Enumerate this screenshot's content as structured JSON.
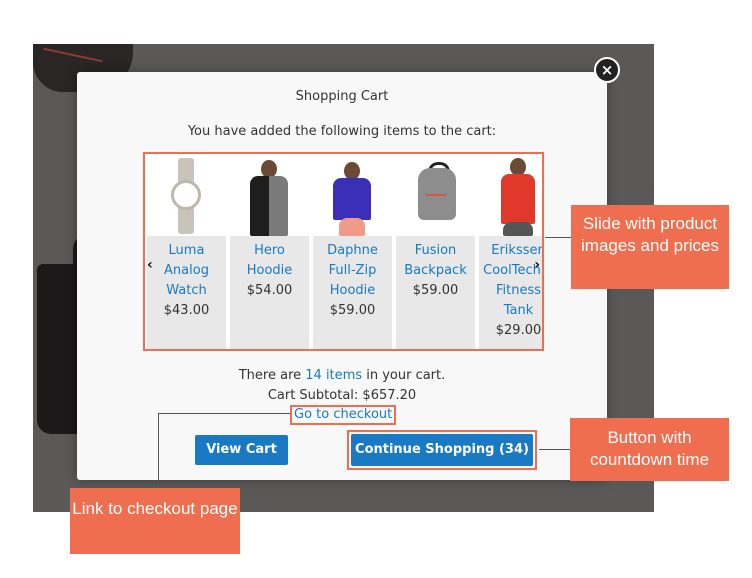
{
  "modal": {
    "title": "Shopping Cart",
    "subtitle": "You have added the following items to the cart:",
    "close_icon": "×"
  },
  "slider": {
    "prev_icon": "‹",
    "next_icon": "›",
    "products": [
      {
        "name_lines": [
          "Luma",
          "Analog",
          "Watch"
        ],
        "price": "$43.00",
        "image": "watch"
      },
      {
        "name_lines": [
          "Hero",
          "Hoodie"
        ],
        "price": "$54.00",
        "image": "man-hoodie"
      },
      {
        "name_lines": [
          "Daphne",
          "Full-Zip",
          "Hoodie"
        ],
        "price": "$59.00",
        "image": "woman-hoodie"
      },
      {
        "name_lines": [
          "Fusion",
          "Backpack"
        ],
        "price": "$59.00",
        "image": "backpack"
      },
      {
        "name_lines": [
          "Erikssen",
          "CoolTech™",
          "Fitness",
          "Tank"
        ],
        "price": "$29.00",
        "image": "man-tank"
      }
    ]
  },
  "summary": {
    "items_prefix": "There are ",
    "items_link": "14 items",
    "items_suffix": " in your cart.",
    "subtotal_label": "Cart Subtotal: ",
    "subtotal_value": "$657.20",
    "checkout_link": "Go to checkout"
  },
  "buttons": {
    "view_cart": "View Cart",
    "continue_shopping": "Continue Shopping (34)"
  },
  "callouts": {
    "slide": "Slide with product images and prices",
    "button": "Button with countdown time",
    "link": "Link to checkout page"
  },
  "colors": {
    "accent": "#ef6e4f",
    "primary_button": "#1979c3",
    "link": "#1979c3",
    "backdrop": "#5a5957"
  }
}
